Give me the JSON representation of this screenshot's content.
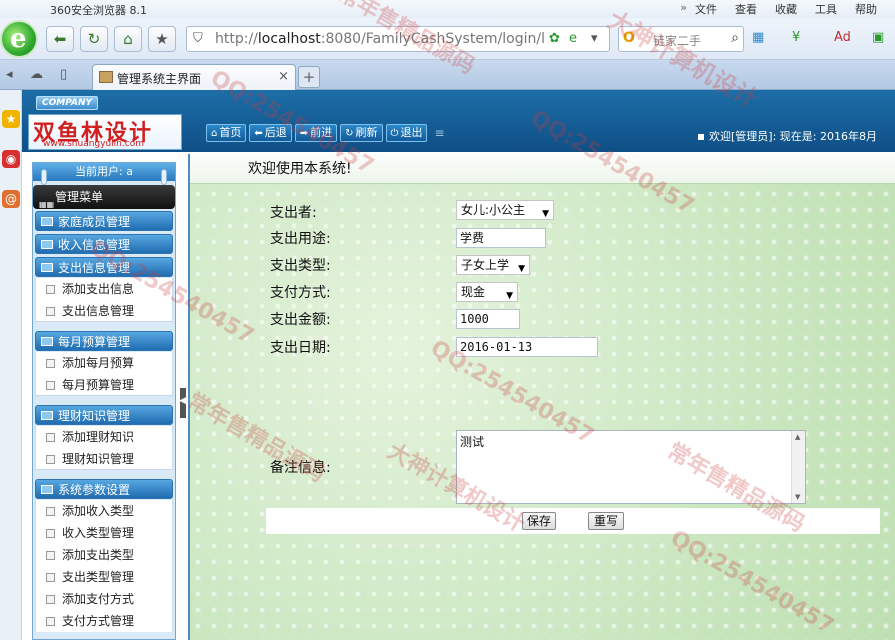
{
  "browser": {
    "app_title": "360安全浏览器 8.1",
    "menu": [
      "»",
      "文件",
      "查看",
      "收藏",
      "工具",
      "帮助"
    ],
    "address_host": "localhost",
    "address_prefix": "http://",
    "address_rest": ":8080/FamilyCashSystem/login/l",
    "search_placeholder": "链家二手",
    "tab_title": "管理系统主界面",
    "new_tab": "+",
    "close_tab": "×"
  },
  "site": {
    "company_badge": "COMPANY",
    "brand_name": "双鱼林设计",
    "brand_url": "www.shuangyulin.com",
    "top_buttons": [
      {
        "icon": "home-icon",
        "glyph": "⌂",
        "label": "首页"
      },
      {
        "icon": "back-icon",
        "glyph": "⬅",
        "label": "后退"
      },
      {
        "icon": "forward-icon",
        "glyph": "➡",
        "label": "前进"
      },
      {
        "icon": "refresh-icon",
        "glyph": "↻",
        "label": "刷新"
      },
      {
        "icon": "power-icon",
        "glyph": "⏻",
        "label": "退出"
      }
    ],
    "welcome_text": "欢迎[管理员]:  现在是: 2016年8月"
  },
  "sidebar": {
    "current_user": "当前用户: a",
    "menu_title": "管理菜单",
    "groups": [
      {
        "label": "家庭成员管理"
      },
      {
        "label": "收入信息管理"
      },
      {
        "label": "支出信息管理",
        "items": [
          "添加支出信息",
          "支出信息管理"
        ]
      },
      {
        "label": "每月预算管理",
        "items": [
          "添加每月预算",
          "每月预算管理"
        ]
      },
      {
        "label": "理财知识管理",
        "items": [
          "添加理财知识",
          "理财知识管理"
        ]
      },
      {
        "label": "系统参数设置",
        "items": [
          "添加收入类型",
          "收入类型管理",
          "添加支出类型",
          "支出类型管理",
          "添加支付方式",
          "支付方式管理"
        ]
      }
    ]
  },
  "main": {
    "welcome": "欢迎使用本系统!",
    "form": {
      "payer_label": "支出者:",
      "payer_value": "女儿:小公主",
      "purpose_label": "支出用途:",
      "purpose_value": "学费",
      "type_label": "支出类型:",
      "type_value": "子女上学",
      "payment_label": "支付方式:",
      "payment_value": "现金",
      "amount_label": "支出金额:",
      "amount_value": "1000",
      "date_label": "支出日期:",
      "date_value": "2016-01-13",
      "remark_label": "备注信息:",
      "remark_value": "测试"
    },
    "save_label": "保存",
    "reset_label": "重写"
  },
  "watermark": {
    "qq": "QQ:254540457",
    "t1": "常年售精品源码",
    "t2": "大神计算机设计"
  }
}
